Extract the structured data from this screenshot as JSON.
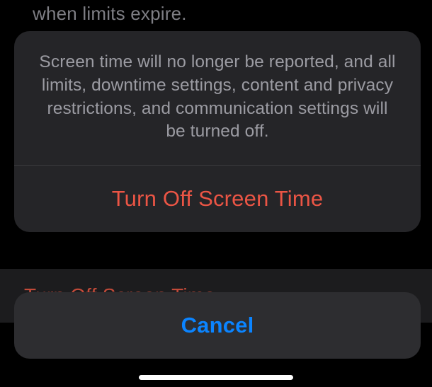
{
  "background": {
    "partial_setting_text": "when limits expire.",
    "row_label": "Turn Off Screen Time"
  },
  "action_sheet": {
    "message": "Screen time will no longer be reported, and all limits, downtime settings, content and privacy restrictions, and communication settings will be turned off.",
    "destructive_label": "Turn Off Screen Time",
    "cancel_label": "Cancel"
  },
  "colors": {
    "destructive": "#eb5545",
    "link": "#0b84ff",
    "sheet_bg": "#252528",
    "cancel_bg": "#2d2d30"
  }
}
